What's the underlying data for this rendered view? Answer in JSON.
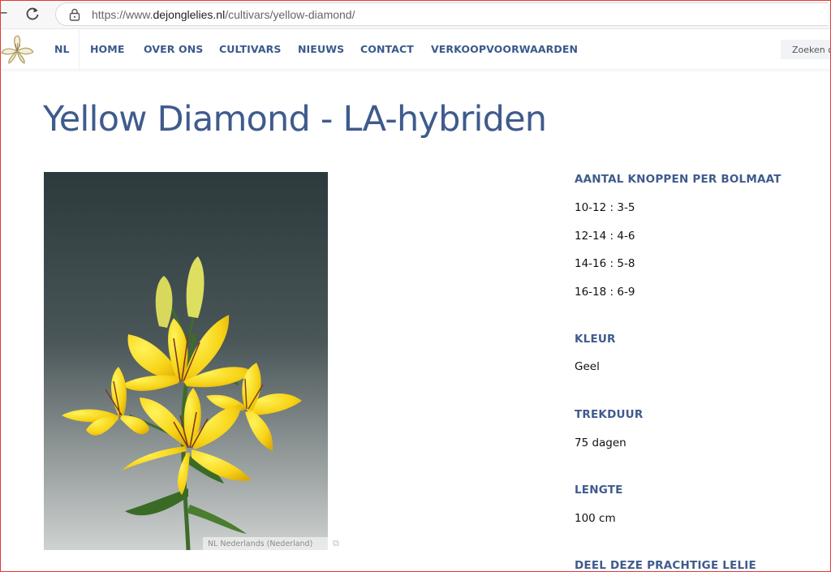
{
  "browser": {
    "url_scheme": "https://www.",
    "url_host": "dejonglelies.nl",
    "url_path": "/cultivars/yellow-diamond/"
  },
  "nav": {
    "items": [
      {
        "label": "NL"
      },
      {
        "label": "HOME"
      },
      {
        "label": "OVER ONS"
      },
      {
        "label": "CULTIVARS"
      },
      {
        "label": "NIEUWS"
      },
      {
        "label": "CONTACT"
      },
      {
        "label": "VERKOOPVOORWAARDEN"
      }
    ],
    "search_placeholder": "Zoeken o"
  },
  "page": {
    "title": "Yellow Diamond - LA-hybriden",
    "image_caption": "NL Nederlands (Nederland)"
  },
  "specs": {
    "buds_heading": "AANTAL KNOPPEN PER BOLMAAT",
    "buds": [
      "10-12 : 3-5",
      "12-14 : 4-6",
      "14-16 : 5-8",
      "16-18 : 6-9"
    ],
    "color_heading": "KLEUR",
    "color_value": "Geel",
    "forcing_heading": "TREKDUUR",
    "forcing_value": "75 dagen",
    "length_heading": "LENGTE",
    "length_value": "100 cm",
    "share_heading": "DEEL DEZE PRACHTIGE LELIE"
  },
  "colors": {
    "brand_blue": "#3f5b8d",
    "nav_blue": "#3a5a8c",
    "frame_red": "#e53935"
  }
}
